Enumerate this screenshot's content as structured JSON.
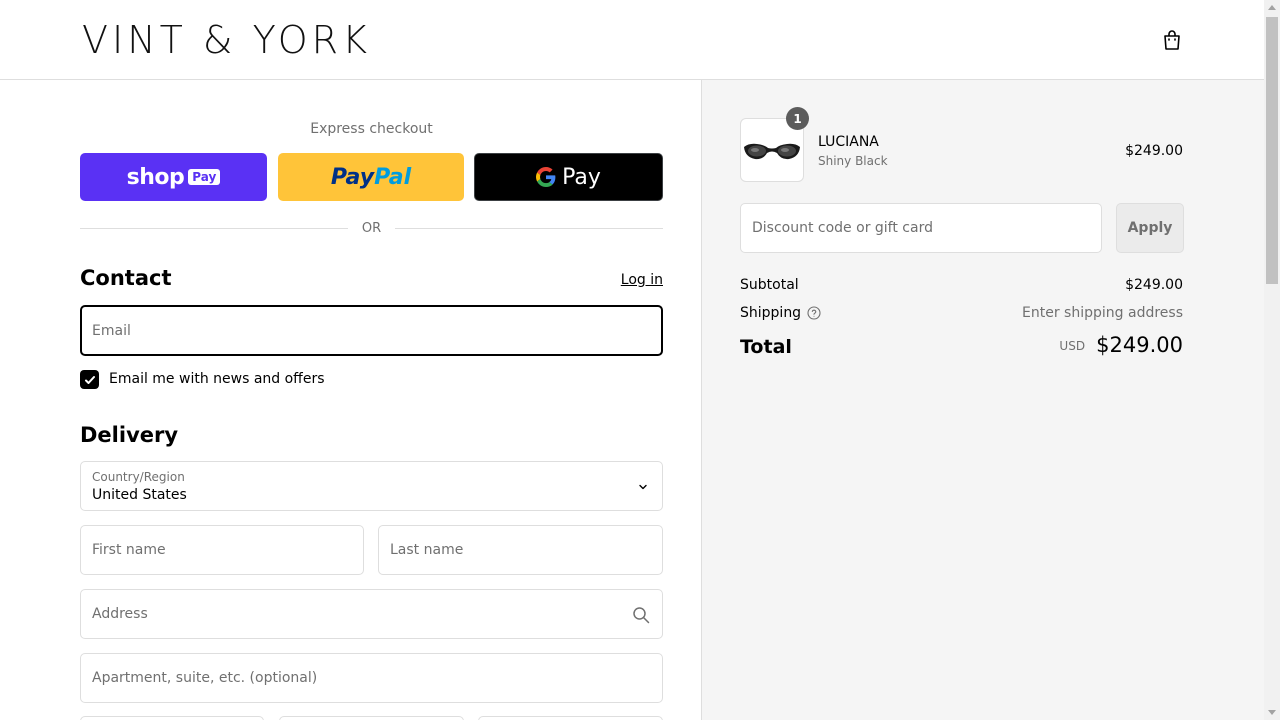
{
  "header": {
    "logo_text": "VINT & YORK",
    "cart_icon": "shopping-bag-icon"
  },
  "express": {
    "title": "Express checkout",
    "shop_pay_label": "shop",
    "shop_pay_badge": "Pay",
    "paypal_part1": "Pay",
    "paypal_part2": "Pal",
    "gpay_label": "Pay",
    "or_label": "OR"
  },
  "contact": {
    "title": "Contact",
    "login_label": "Log in",
    "email_placeholder": "Email",
    "newsletter_label": "Email me with news and offers"
  },
  "delivery": {
    "title": "Delivery",
    "country_label": "Country/Region",
    "country_value": "United States",
    "first_name_placeholder": "First name",
    "last_name_placeholder": "Last name",
    "address_placeholder": "Address",
    "apartment_placeholder": "Apartment, suite, etc. (optional)"
  },
  "summary": {
    "product": {
      "name": "LUCIANA",
      "variant": "Shiny Black",
      "price": "$249.00",
      "quantity": "1"
    },
    "discount_placeholder": "Discount code or gift card",
    "apply_label": "Apply",
    "subtotal_label": "Subtotal",
    "subtotal_value": "$249.00",
    "shipping_label": "Shipping",
    "shipping_value": "Enter shipping address",
    "total_label": "Total",
    "total_currency": "USD",
    "total_value": "$249.00"
  },
  "colors": {
    "shop_pay": "#5a31f4",
    "paypal": "#ffc439",
    "gpay": "#000000",
    "summary_bg": "#f5f5f5",
    "border": "#dedede",
    "muted_text": "#707070"
  }
}
